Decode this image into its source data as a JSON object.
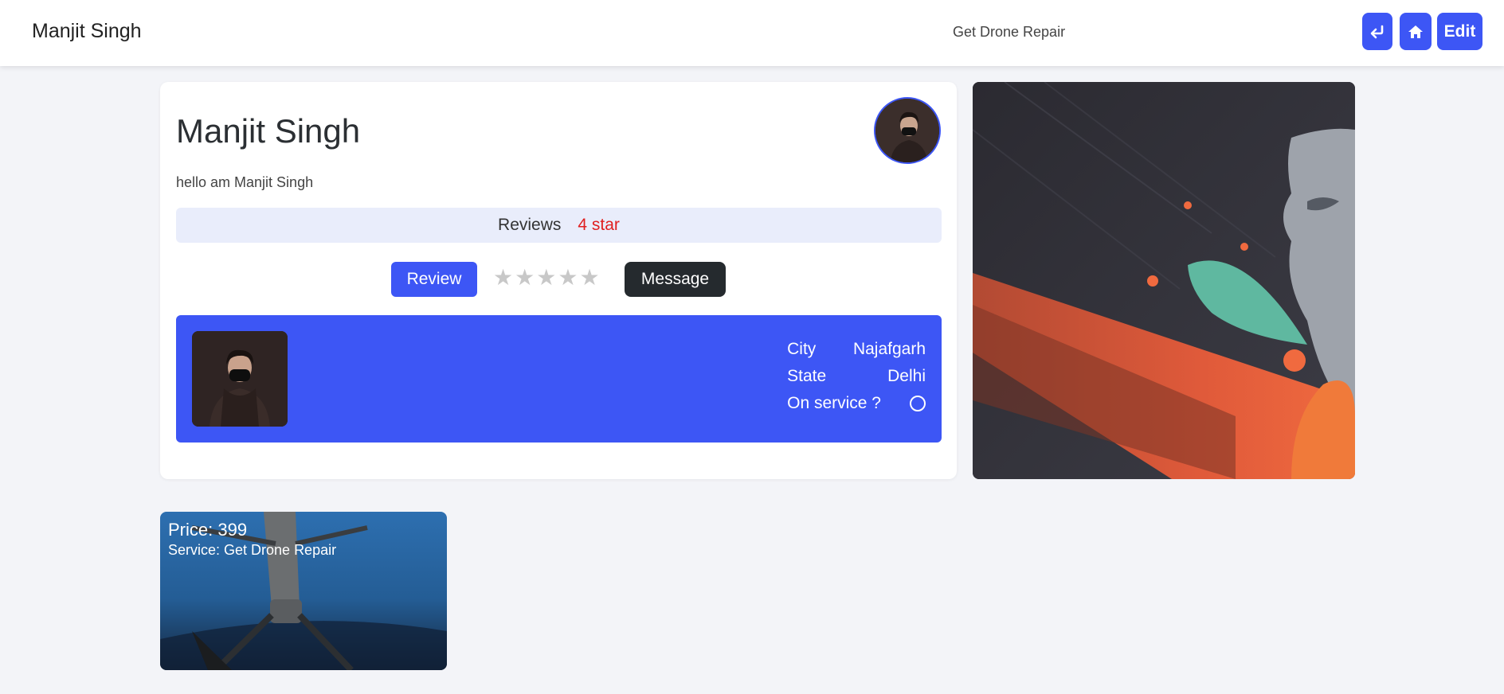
{
  "navbar": {
    "brand": "Manjit Singh",
    "service": "Get Drone Repair",
    "edit_label": "Edit",
    "back_icon": "return-arrow-icon",
    "home_icon": "home-icon",
    "accent": "#3d56f5"
  },
  "profile": {
    "name": "Manjit Singh",
    "bio": "hello am Manjit Singh",
    "reviews_label": "Reviews",
    "reviews_value": "4 star",
    "review_button": "Review",
    "message_button": "Message",
    "rating_stars": [
      "★",
      "★",
      "★",
      "★",
      "★"
    ],
    "rating_filled": 0
  },
  "info": {
    "city_label": "City",
    "city_value": "Najafgarh",
    "state_label": "State",
    "state_value": "Delhi",
    "service_label": "On service ?",
    "on_service": false
  },
  "service_card": {
    "price": "Price: 399",
    "service": "Service: Get Drone Repair"
  },
  "colors": {
    "accent": "#3d56f5",
    "reviews_value": "#e02020",
    "message_button": "#252a2e"
  }
}
